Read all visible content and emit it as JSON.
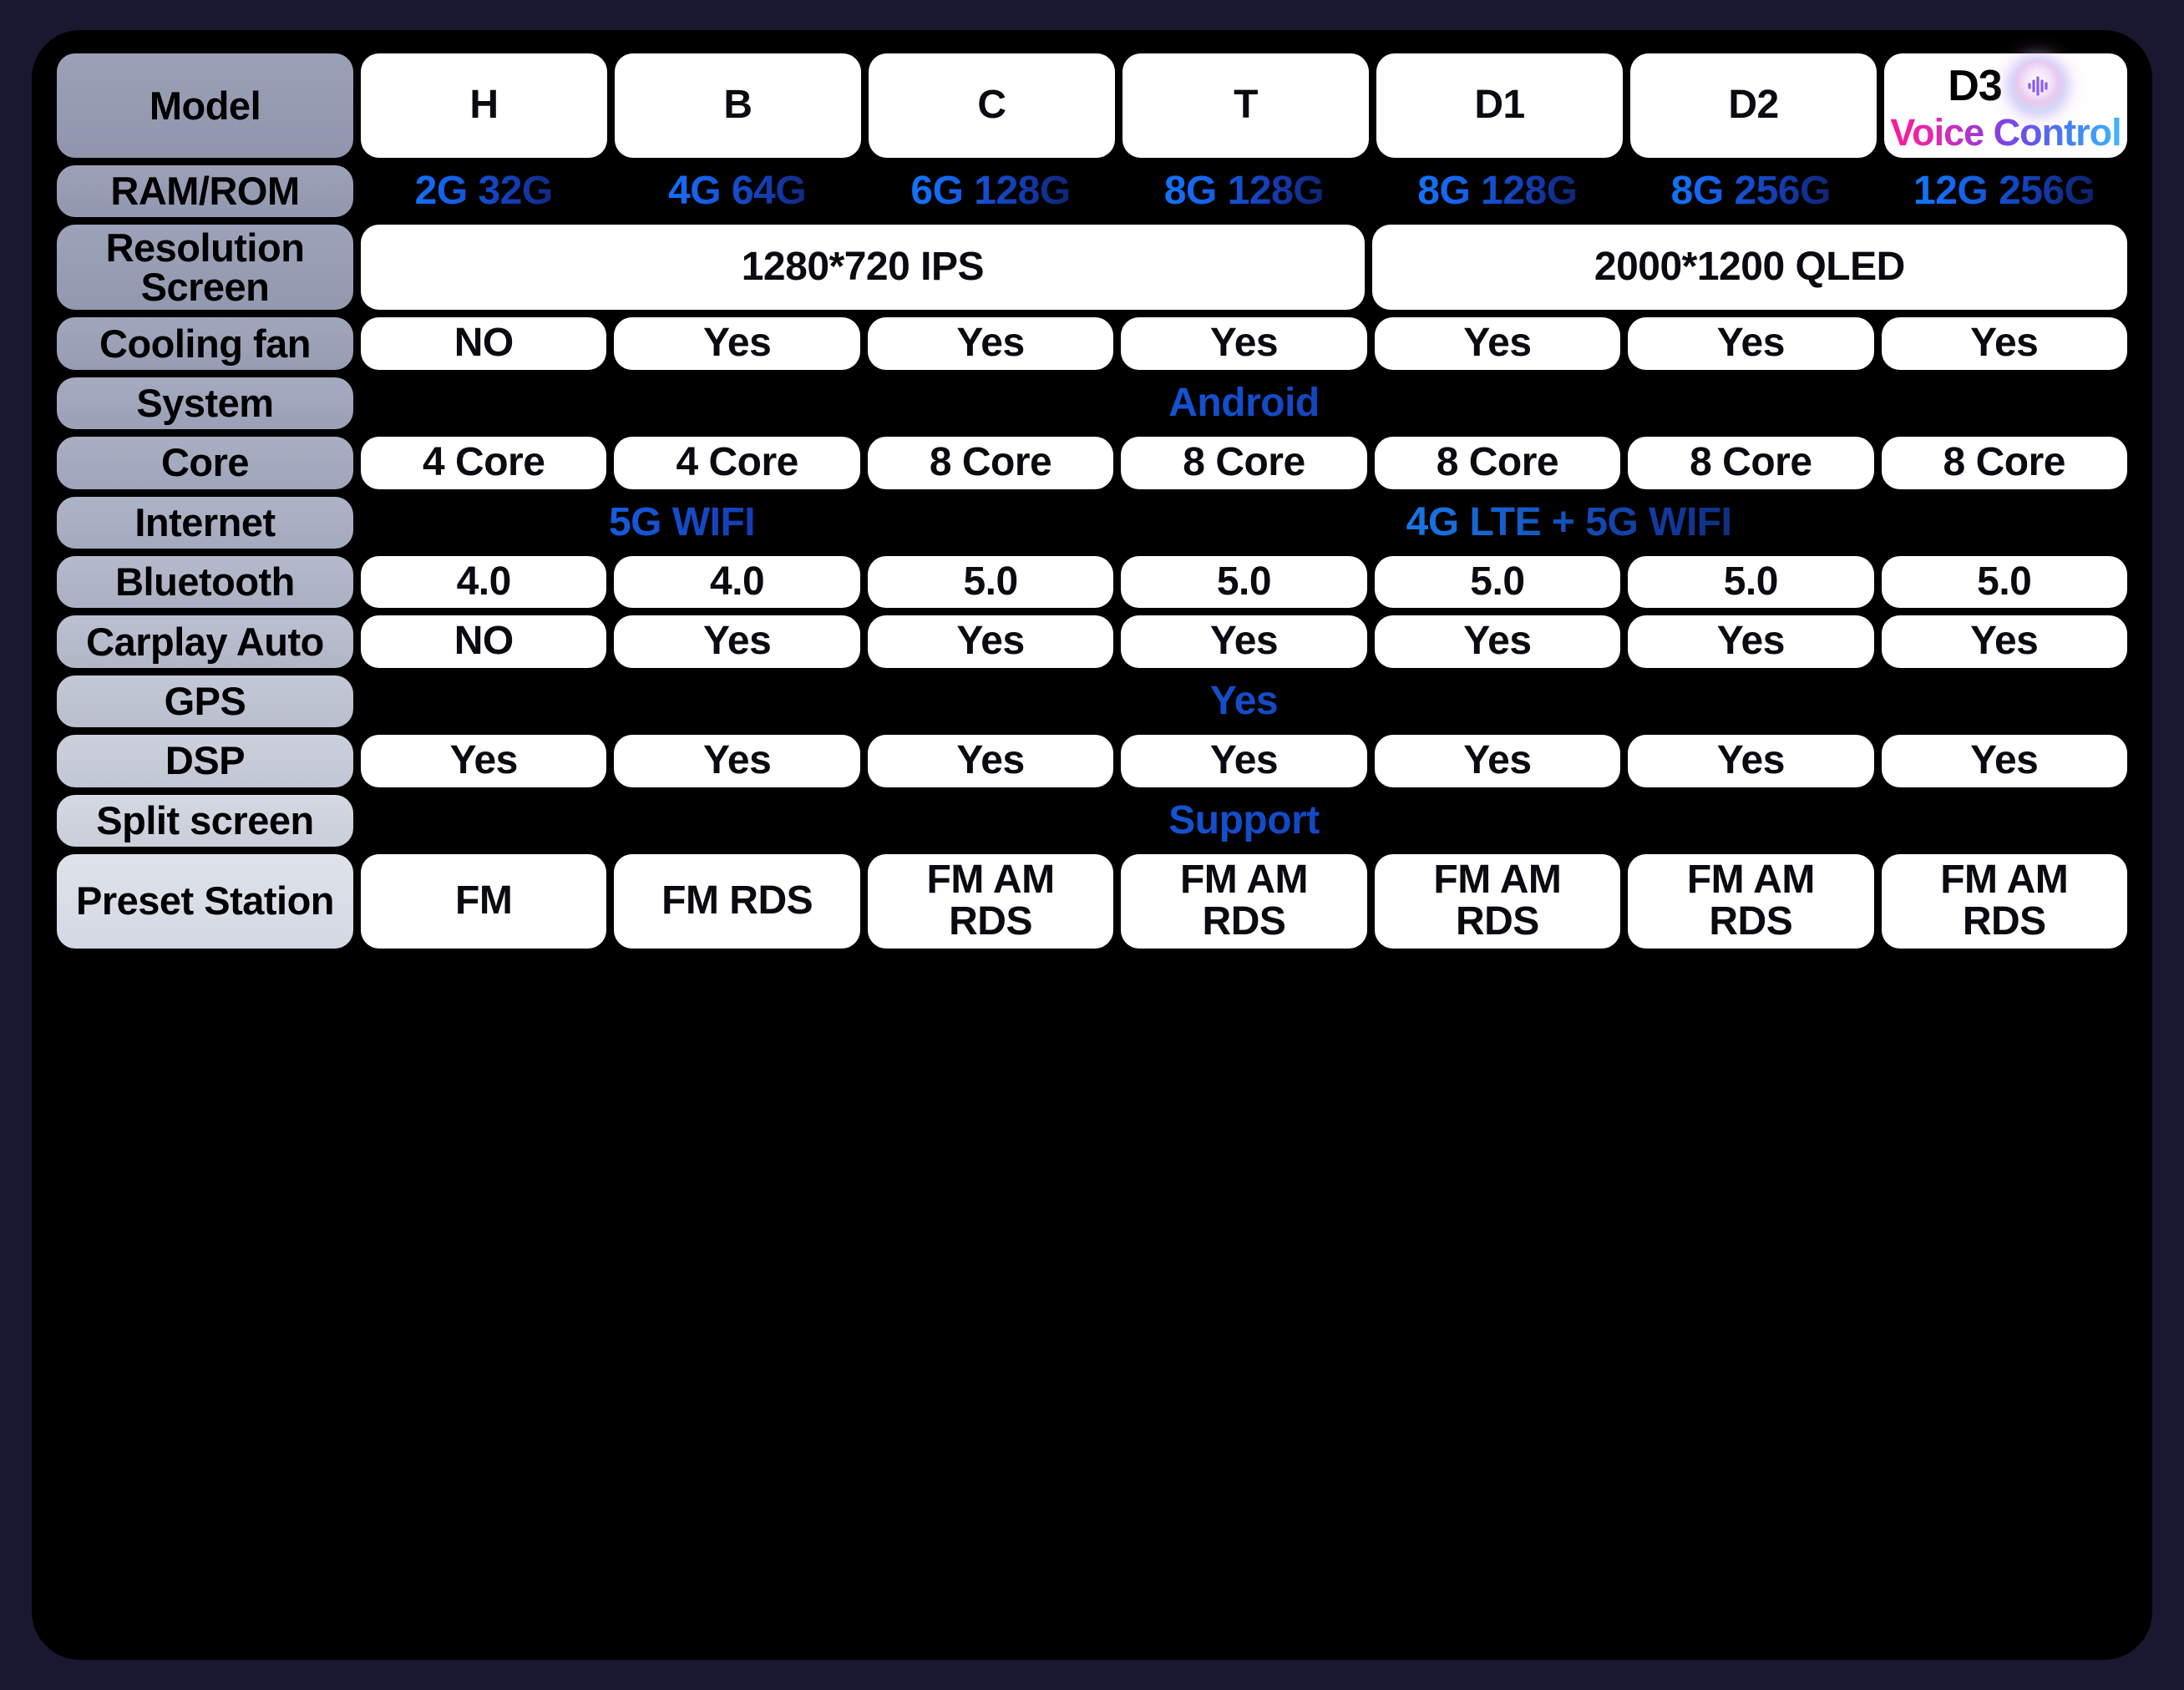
{
  "theme": {
    "page_bg": "#191830",
    "panel_bg": "#000000",
    "cell_bg": "#ffffff",
    "accent_blue": "#0d86ff",
    "accent_navy": "#0b1038",
    "accent_pink": "#ff179a",
    "accent_cyan": "#41b6f7"
  },
  "models": [
    "H",
    "B",
    "C",
    "T",
    "D1",
    "D2",
    "D3"
  ],
  "d3": {
    "name": "D3",
    "tagline": "Voice Control",
    "icon": "voice-waveform-icon"
  },
  "rows": {
    "model": {
      "label": "Model",
      "values": [
        "H",
        "B",
        "C",
        "T",
        "D1",
        "D2"
      ]
    },
    "ram_rom": {
      "label": "RAM/ROM",
      "values": [
        "2G 32G",
        "4G 64G",
        "6G 128G",
        "8G 128G",
        "8G 128G",
        "8G 256G",
        "12G 256G"
      ]
    },
    "resolution": {
      "label": "Resolution\nScreen",
      "values": [
        "1280*720 IPS",
        "2000*1200 QLED"
      ]
    },
    "cooling_fan": {
      "label": "Cooling fan",
      "values": [
        "NO",
        "Yes",
        "Yes",
        "Yes",
        "Yes",
        "Yes",
        "Yes"
      ]
    },
    "system": {
      "label": "System",
      "values": [
        "Android"
      ]
    },
    "core": {
      "label": "Core",
      "values": [
        "4 Core",
        "4 Core",
        "8 Core",
        "8 Core",
        "8 Core",
        "8 Core",
        "8 Core"
      ]
    },
    "internet": {
      "label": "Internet",
      "values": [
        "5G WIFI",
        "4G LTE + 5G WIFI"
      ]
    },
    "bluetooth": {
      "label": "Bluetooth",
      "values": [
        "4.0",
        "4.0",
        "5.0",
        "5.0",
        "5.0",
        "5.0",
        "5.0"
      ]
    },
    "carplay_auto": {
      "label": "Carplay Auto",
      "values": [
        "NO",
        "Yes",
        "Yes",
        "Yes",
        "Yes",
        "Yes",
        "Yes"
      ]
    },
    "gps": {
      "label": "GPS",
      "values": [
        "Yes"
      ]
    },
    "dsp": {
      "label": "DSP",
      "values": [
        "Yes",
        "Yes",
        "Yes",
        "Yes",
        "Yes",
        "Yes",
        "Yes"
      ]
    },
    "split_screen": {
      "label": "Split screen",
      "values": [
        "Support"
      ]
    },
    "preset_station": {
      "label": "Preset Station",
      "values": [
        "FM",
        "FM RDS",
        "FM AM\nRDS",
        "FM AM\nRDS",
        "FM AM\nRDS",
        "FM AM\nRDS",
        "FM AM\nRDS"
      ]
    }
  }
}
